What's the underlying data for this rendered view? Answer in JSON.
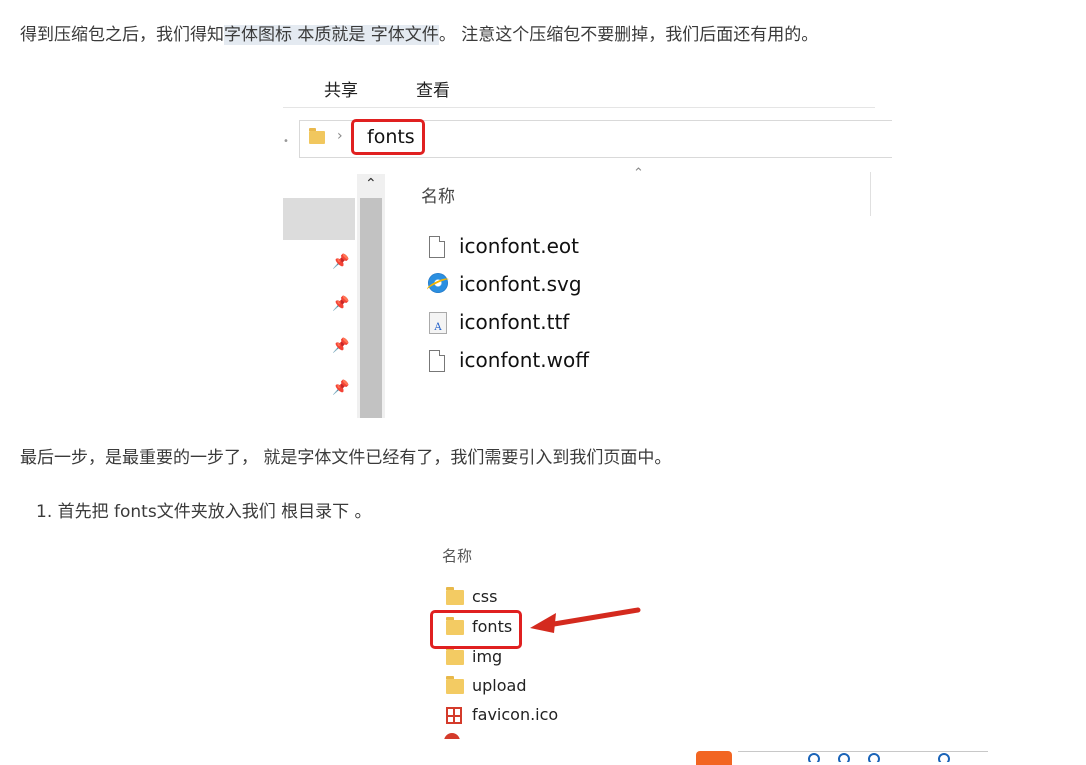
{
  "doc": {
    "para1_before": "得到压缩包之后，我们得知",
    "para1_highlight1": "字体图标 本质就是 字体文件",
    "para1_after": "。 注意这个压缩包不要删掉，我们后面还有用的。",
    "para2": "最后一步，是最重要的一步了， 就是字体文件已经有了，我们需要引入到我们页面中。",
    "list_item_1": "1. 首先把 fonts文件夹放入我们 根目录下 。"
  },
  "explorer1": {
    "tabs": [
      "共享",
      "查看"
    ],
    "address_folder": "fonts",
    "column_header": "名称",
    "files": [
      {
        "name": "iconfont.eot",
        "icon": "document-icon"
      },
      {
        "name": "iconfont.svg",
        "icon": "ie-icon"
      },
      {
        "name": "iconfont.ttf",
        "icon": "font-file-icon"
      },
      {
        "name": "iconfont.woff",
        "icon": "document-icon"
      }
    ]
  },
  "explorer2": {
    "column_header": "名称",
    "items": [
      {
        "name": "css",
        "icon": "folder-icon"
      },
      {
        "name": "fonts",
        "icon": "folder-icon"
      },
      {
        "name": "img",
        "icon": "folder-icon"
      },
      {
        "name": "upload",
        "icon": "folder-icon"
      },
      {
        "name": "favicon.ico",
        "icon": "favicon-icon"
      }
    ]
  },
  "colors": {
    "highlight_box": "#e02020",
    "folder": "#f3cb63",
    "selection_bg": "#e4eaf1"
  }
}
